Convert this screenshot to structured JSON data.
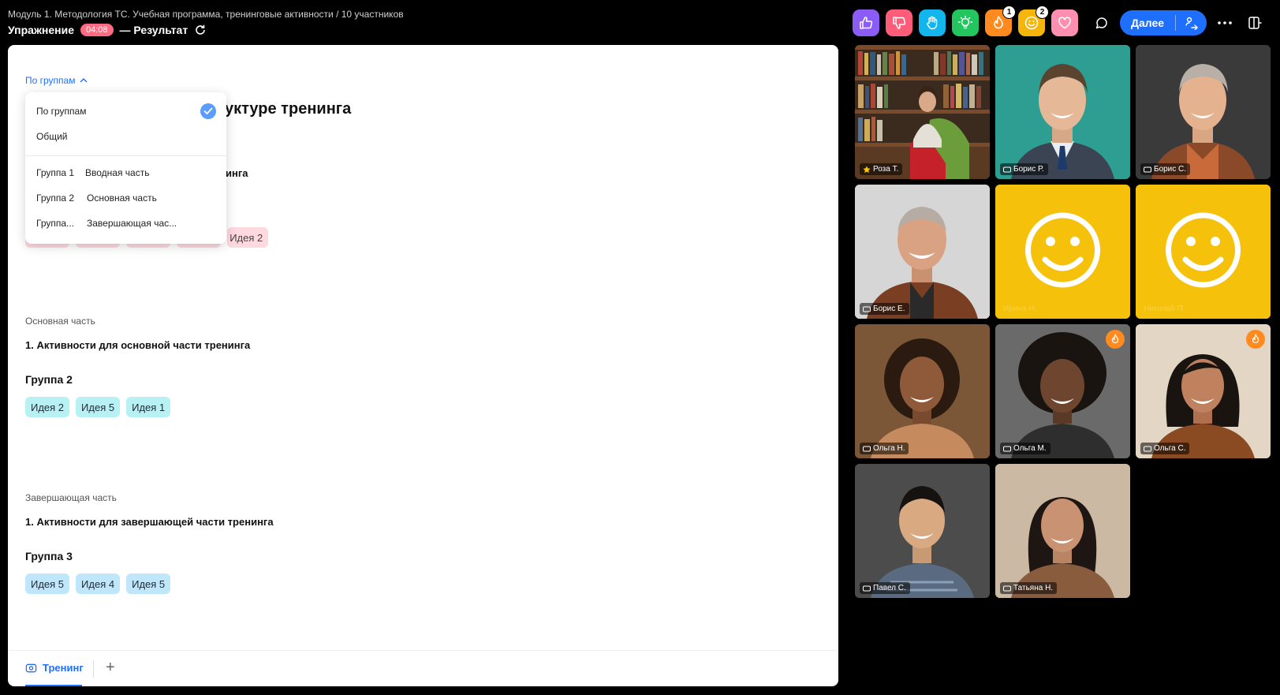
{
  "header": {
    "breadcrumb": "Модуль 1. Методология ТС. Учебная программа, тренинговые активности / 10 участников",
    "exercise_label": "Упражнение",
    "timer": "04:08",
    "result_label": "— Результат",
    "reactions": [
      {
        "name": "like",
        "color": "#8b5cf6",
        "badge": ""
      },
      {
        "name": "dislike",
        "color": "#ff5c7a",
        "badge": ""
      },
      {
        "name": "hand",
        "color": "#12b5ec",
        "badge": ""
      },
      {
        "name": "idea",
        "color": "#22c55e",
        "badge": ""
      },
      {
        "name": "fire",
        "color": "#ff8a1f",
        "badge": "1"
      },
      {
        "name": "smile",
        "color": "#f5b50a",
        "badge": "2"
      },
      {
        "name": "heart",
        "color": "#ff8fb0",
        "badge": ""
      }
    ],
    "next_label": "Далее"
  },
  "panel": {
    "view_toggle": "По группам",
    "partial_title": "уктуре тренинга",
    "partial_subtitle": "инга",
    "partial_tag": "Идея 2",
    "dropdown": {
      "options": [
        "По группам",
        "Общий"
      ],
      "groups": [
        {
          "group": "Группа 1",
          "part": "Вводная часть"
        },
        {
          "group": "Группа 2",
          "part": "Основная часть"
        },
        {
          "group": "Группа...",
          "part": "Завершающая час..."
        }
      ]
    },
    "sections": [
      {
        "label": "Основная часть",
        "title": "1. Активности для основной части тренинга",
        "group": "Группа 2",
        "ideas": [
          "Идея 2",
          "Идея 5",
          "Идея 1"
        ]
      },
      {
        "label": "Завершающая часть",
        "title": "1. Активности для завершающей части тренинга",
        "group": "Группа 3",
        "ideas": [
          "Идея 5",
          "Идея 4",
          "Идея 5"
        ]
      }
    ],
    "tab_label": "Тренинг",
    "add_tab": "+"
  },
  "participants": [
    {
      "name": "Роза Т.",
      "host": true
    },
    {
      "name": "Борис Р.",
      "host": false
    },
    {
      "name": "Борис С.",
      "host": false
    },
    {
      "name": "Борис Е.",
      "host": false
    },
    {
      "name": "Ирина Н.",
      "host": false,
      "avatar": "smile"
    },
    {
      "name": "Николай П.",
      "host": false,
      "avatar": "smile"
    },
    {
      "name": "Ольга Н.",
      "host": false
    },
    {
      "name": "Ольга М.",
      "host": false,
      "reaction": "fire"
    },
    {
      "name": "Ольга С.",
      "host": false,
      "reaction": "fire"
    },
    {
      "name": "Павел С.",
      "host": false
    },
    {
      "name": "Татьяна Н.",
      "host": false
    }
  ]
}
